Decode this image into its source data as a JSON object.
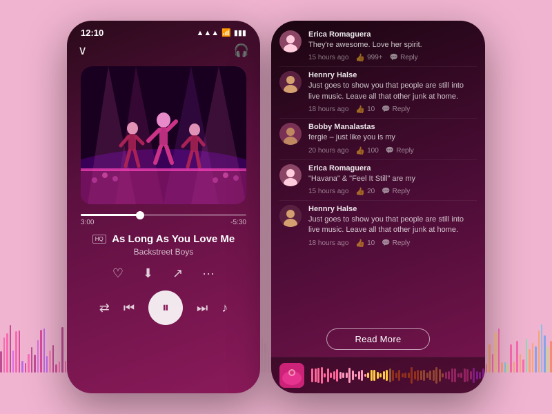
{
  "background_color": "#f0b4d0",
  "left_phone": {
    "status": {
      "time": "12:10",
      "signal": "▲▲▲",
      "wifi": "wifi",
      "battery": "🔋"
    },
    "time_current": "3:00",
    "time_total": "-5:30",
    "quality_badge": "HQ",
    "song_title": "As Long As You Love Me",
    "song_artist": "Backstreet Boys",
    "progress_percent": 36
  },
  "right_phone": {
    "comments": [
      {
        "id": 1,
        "username": "Erica Romaguera",
        "text": "They're awesome. Love her spirit.",
        "time": "15 hours ago",
        "likes": "999+",
        "replies": "Reply"
      },
      {
        "id": 2,
        "username": "Hennry Halse",
        "text": "Just goes to show you that people are still into live music. Leave all that other junk at home.",
        "time": "18 hours ago",
        "likes": "10",
        "replies": "Reply"
      },
      {
        "id": 3,
        "username": "Bobby Manalastas",
        "text": "fergie – just like you is my",
        "time": "20 hours ago",
        "likes": "100",
        "replies": "Reply"
      },
      {
        "id": 4,
        "username": "Erica Romaguera",
        "text": "\"Havana\" & \"Feel It Still\" are my",
        "time": "15 hours ago",
        "likes": "20",
        "replies": "Reply"
      },
      {
        "id": 5,
        "username": "Hennry Halse",
        "text": "Just goes to show you that people are still into live music. Leave all that other junk at home.",
        "time": "18 hours ago",
        "likes": "10",
        "replies": "Reply"
      }
    ],
    "read_more_label": "Read More"
  },
  "icons": {
    "chevron_down": "❮",
    "headphone": "🎧",
    "heart": "♡",
    "download": "⬇",
    "share": "↗",
    "more": "···",
    "shuffle": "⇄",
    "prev": "⏮",
    "play_pause": "⏸",
    "next": "⏭",
    "music_note": "♪",
    "like": "👍",
    "reply_chat": "💬"
  }
}
